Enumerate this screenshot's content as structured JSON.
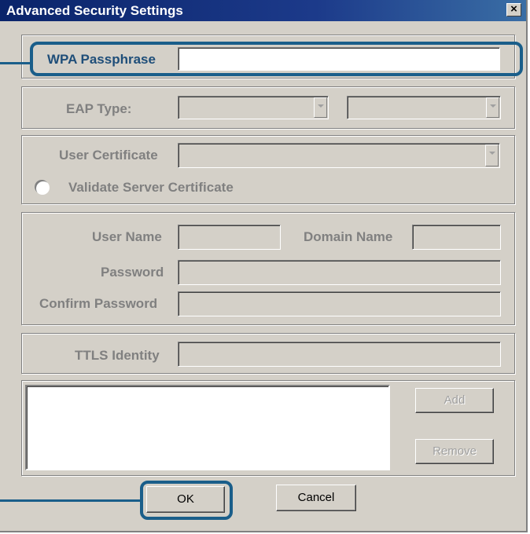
{
  "window": {
    "title": "Advanced Security Settings",
    "close_label": "×"
  },
  "passphrase": {
    "label": "WPA Passphrase",
    "value": ""
  },
  "eap": {
    "label": "EAP Type:",
    "selected": "",
    "selected_secondary": ""
  },
  "certificate": {
    "label": "User Certificate",
    "selected": "",
    "validate_label": "Validate Server Certificate"
  },
  "credentials": {
    "user_name_label": "User Name",
    "domain_name_label": "Domain Name",
    "password_label": "Password",
    "confirm_password_label": "Confirm Password"
  },
  "ttls": {
    "label": "TTLS Identity"
  },
  "list": {
    "add_label": "Add",
    "remove_label": "Remove"
  },
  "buttons": {
    "ok_label": "OK",
    "cancel_label": "Cancel"
  },
  "colors": {
    "highlight": "#1a5e8a",
    "titlebar": "#0a246a",
    "face": "#d4d0c8"
  }
}
